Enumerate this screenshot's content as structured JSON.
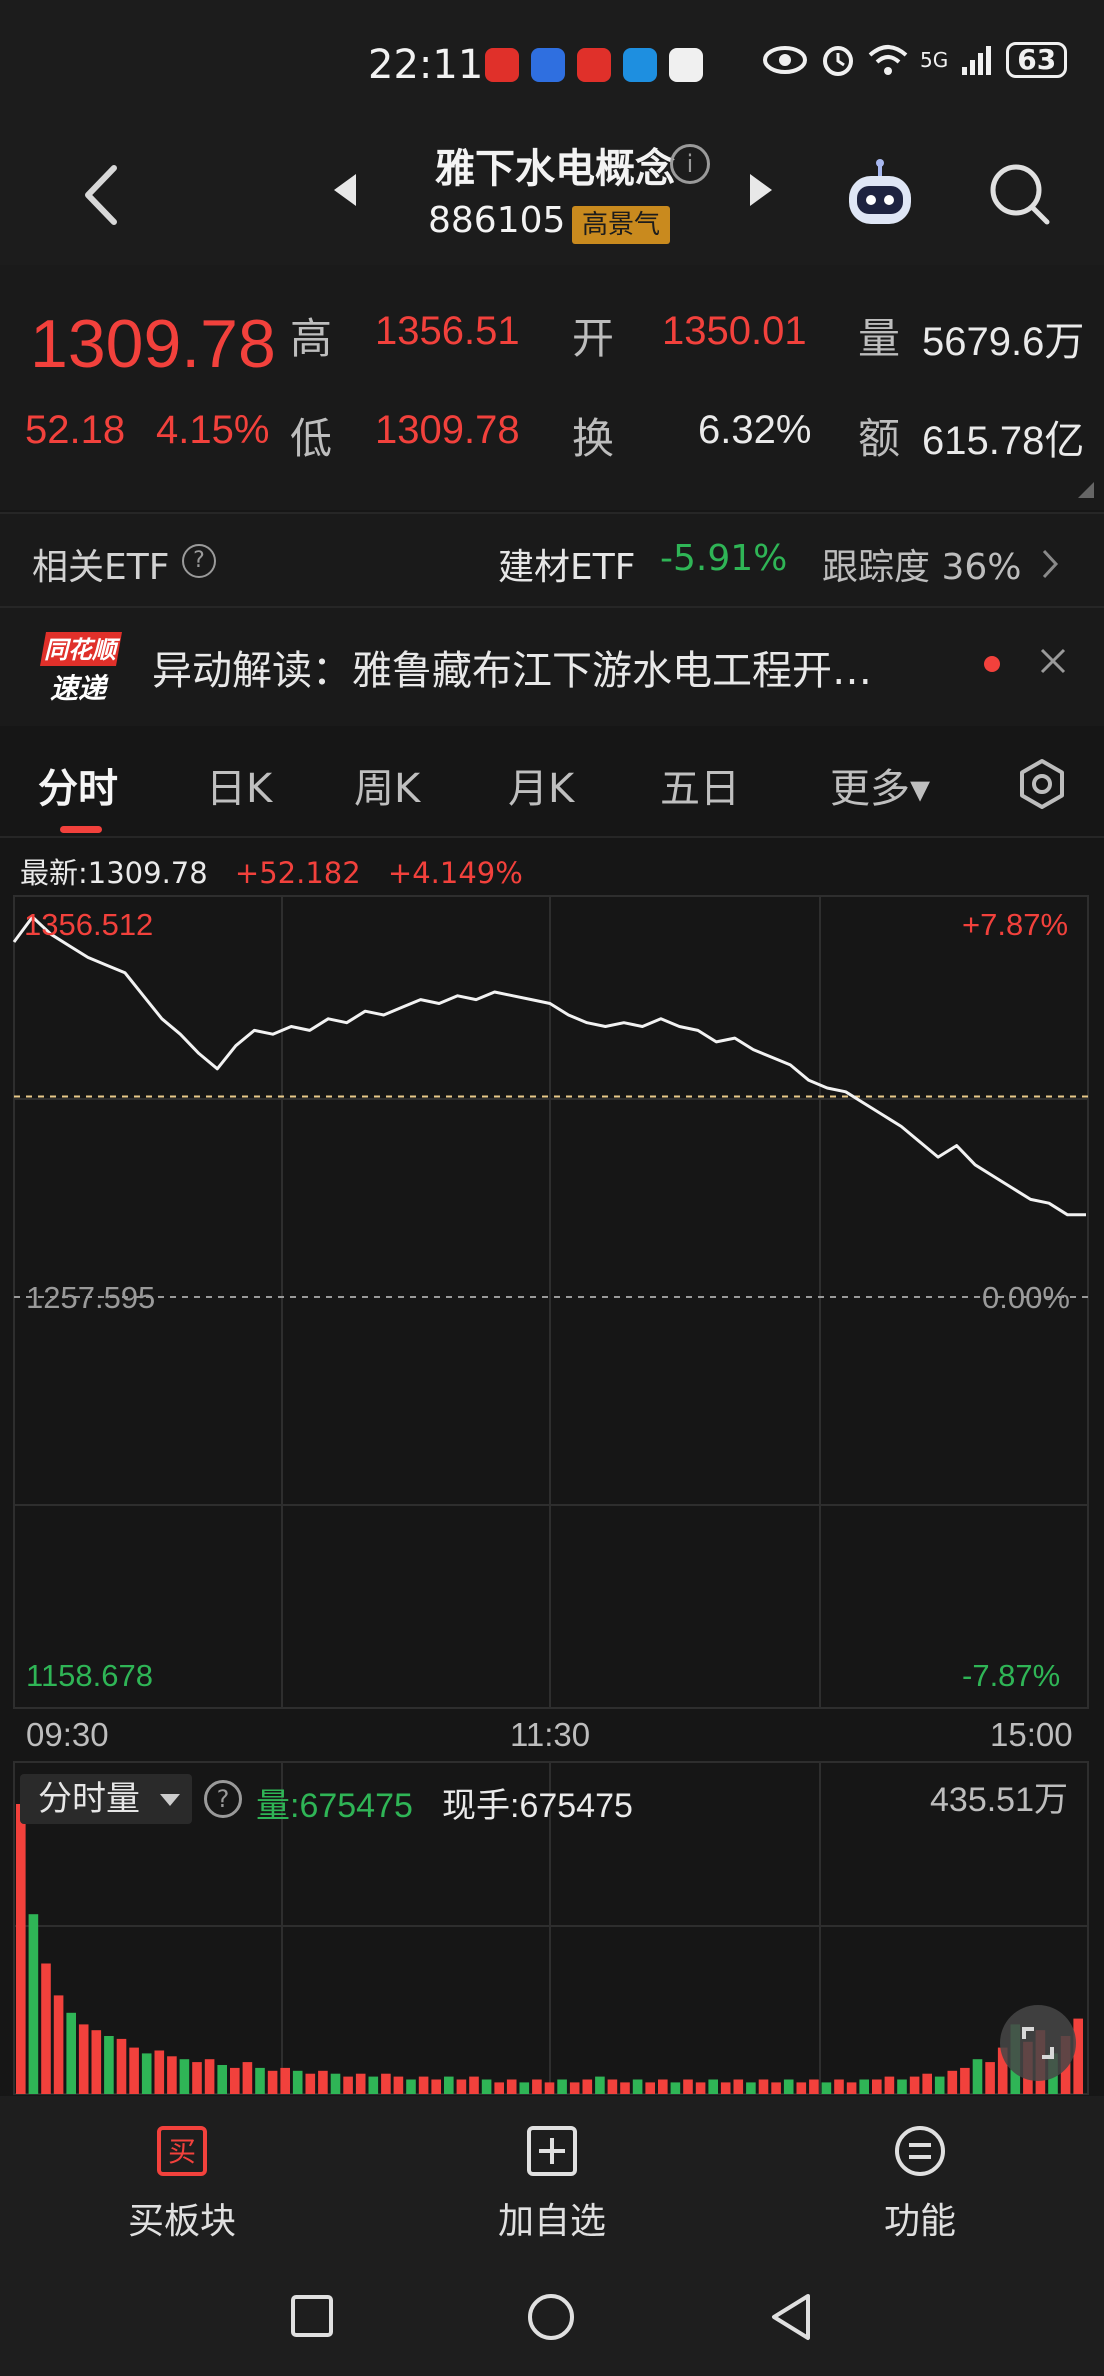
{
  "status_bar": {
    "time": "22:11",
    "battery": "63",
    "network": "5G"
  },
  "header": {
    "title": "雅下水电概念",
    "code": "886105",
    "badge": "高景气"
  },
  "quote": {
    "price": "1309.78",
    "change": "52.18",
    "change_pct": "4.15%",
    "high_label": "高",
    "high": "1356.51",
    "open_label": "开",
    "open": "1350.01",
    "volume_label": "量",
    "volume": "5679.6万",
    "low_label": "低",
    "low": "1309.78",
    "turnover_label": "换",
    "turnover": "6.32%",
    "amount_label": "额",
    "amount": "615.78亿"
  },
  "etf": {
    "label": "相关ETF",
    "name": "建材ETF",
    "change": "-5.91%",
    "tracking_label": "跟踪度",
    "tracking": "36%"
  },
  "news": {
    "logo_top": "同花顺",
    "logo_bottom": "速递",
    "text": "异动解读：雅鲁藏布江下游水电工程开…"
  },
  "tabs": [
    {
      "label": "分时"
    },
    {
      "label": "日K"
    },
    {
      "label": "周K"
    },
    {
      "label": "月K"
    },
    {
      "label": "五日"
    },
    {
      "label": "更多▾"
    }
  ],
  "chart_info": {
    "latest": "最新:1309.78",
    "change": "+52.182",
    "change_pct": "+4.149%"
  },
  "chart_data": {
    "type": "line",
    "y_labels": {
      "top": "1356.512",
      "mid": "1257.595",
      "bottom": "1158.678",
      "top_pct": "+7.87%",
      "mid_pct": "0.00%",
      "bottom_pct": "-7.87%"
    },
    "x_labels": [
      "09:30",
      "11:30",
      "15:00"
    ],
    "ylim": [
      1158.678,
      1356.512
    ],
    "prev_close": 1257.595,
    "reference_price": 1309.78,
    "series": [
      {
        "values": [
          1350,
          1356.5,
          1352,
          1349,
          1346,
          1344,
          1342,
          1336,
          1330,
          1326,
          1321,
          1317,
          1323,
          1327,
          1326,
          1328,
          1327,
          1330,
          1329,
          1332,
          1331,
          1333,
          1335,
          1334,
          1336,
          1335,
          1337,
          1336,
          1335,
          1334,
          1331,
          1329,
          1328,
          1329,
          1328,
          1330,
          1328,
          1327,
          1324,
          1325,
          1322,
          1320,
          1318,
          1314,
          1312,
          1311,
          1308,
          1305,
          1302,
          1298,
          1294,
          1297,
          1292,
          1289,
          1286,
          1283,
          1282,
          1279,
          1279
        ]
      }
    ],
    "volume": {
      "label": "分时量",
      "amount": "量:675475",
      "hand": "现手:675475",
      "max_label": "435.51万",
      "bars": [
        100,
        62,
        45,
        34,
        28,
        24,
        22,
        20,
        19,
        16,
        14,
        15,
        13,
        12,
        11,
        12,
        10,
        9,
        11,
        9,
        8,
        9,
        8,
        7,
        8,
        7,
        6,
        7,
        6,
        7,
        6,
        5,
        6,
        5,
        6,
        5,
        6,
        5,
        4,
        5,
        4,
        5,
        4,
        5,
        4,
        5,
        6,
        5,
        4,
        5,
        4,
        5,
        4,
        5,
        4,
        5,
        4,
        5,
        4,
        5,
        4,
        5,
        4,
        5,
        4,
        5,
        4,
        5,
        5,
        6,
        5,
        6,
        7,
        6,
        8,
        9,
        12,
        11,
        16,
        24,
        18,
        22,
        14,
        20,
        26
      ]
    }
  },
  "bottom_bar": [
    {
      "label": "买板块",
      "icon_glyph": "买"
    },
    {
      "label": "加自选",
      "icon_glyph": "+"
    },
    {
      "label": "功能",
      "icon_glyph": "≡"
    }
  ],
  "colors": {
    "up": "#f2413c",
    "down": "#2fb556",
    "background": "#161616",
    "badge": "#c98a1e"
  }
}
